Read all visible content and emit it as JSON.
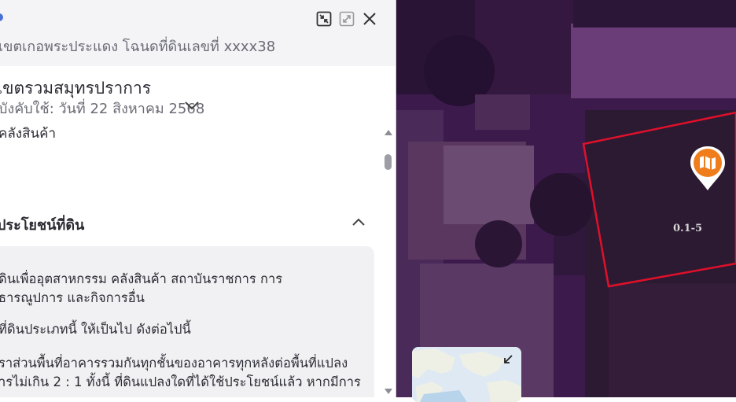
{
  "panel": {
    "subtitle": "เขตเกอพระประแดง โฉนดที่ดินเลขที่ xxxx38",
    "province": "เขตรวมสมุทรปราการ",
    "effective_date": "บังคับใช้: วันที่ 22 สิงหาคม 2568",
    "zone_type": "คลังสินค้า",
    "section_title": "ประโยชน์ที่ดิน",
    "rules": [
      "ดินเพื่ออุตสาหกรรม คลังสินค้า สถาบันราชการ การ",
      "ธารณูปการ และกิจการอื่น",
      "ที่ดินประเภทนี้ ให้เป็นไป ดังต่อไปนี้",
      "ราส่วนพื้นที่อาคารรวมกันทุกชั้นของอาคารทุกหลังต่อพื้นที่แปลง",
      "ารไม่เกิน 2 : 1 ทั้งนี้ ที่ดินแปลงใดที่ได้ใช้ประโยชน์แล้ว หากมีการ"
    ],
    "controls": [
      "collapse-icon",
      "expand-icon",
      "close-icon"
    ]
  },
  "map": {
    "plot_label": "0.1-5",
    "plot_outline_color": "#e0102b",
    "pin_color": "#f07d1c",
    "overlay_color": "#5a2272"
  }
}
